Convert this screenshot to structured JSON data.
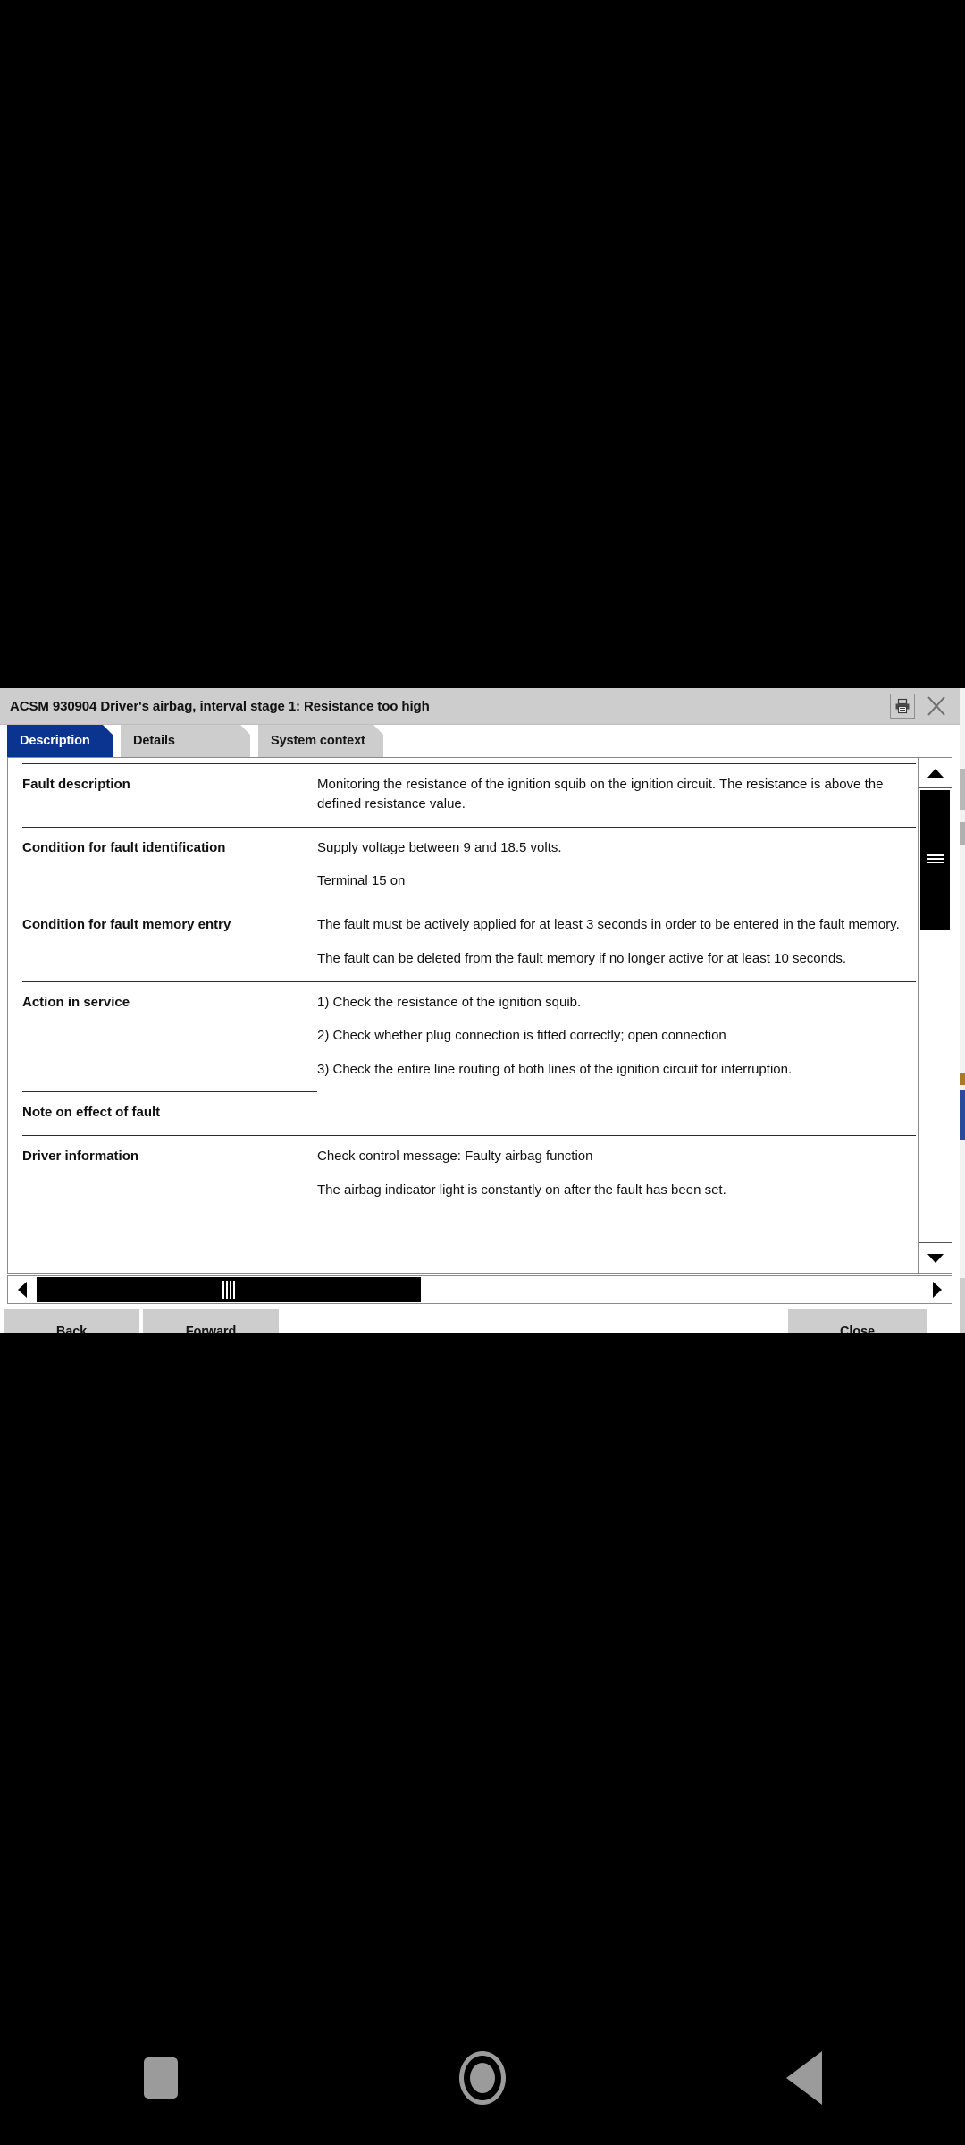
{
  "window": {
    "title": "ACSM 930904 Driver's airbag, interval stage 1: Resistance too high",
    "print_icon": "printer-icon",
    "close_icon": "close-x-icon",
    "accent_color": "#0b3491",
    "chrome_color": "#cdcdcd"
  },
  "tabs": [
    {
      "label": "Description",
      "active": true
    },
    {
      "label": "Details",
      "active": false
    },
    {
      "label": "System context",
      "active": false
    }
  ],
  "table": {
    "rows": [
      {
        "label": "Fault description",
        "paragraphs": [
          "Monitoring the resistance of the ignition squib on the ignition circuit. The resistance is above the defined resistance value."
        ]
      },
      {
        "label": "Condition for fault identification",
        "paragraphs": [
          "Supply voltage between 9 and 18.5 volts.",
          "Terminal 15 on"
        ]
      },
      {
        "label": "Condition for fault memory entry",
        "paragraphs": [
          "The fault must be actively applied for at least 3 seconds in order to be entered in the fault memory.",
          "The fault can be deleted from the fault memory if no longer active for at least 10 seconds."
        ]
      },
      {
        "label": "Action in service",
        "paragraphs": [
          "1) Check the resistance of the ignition squib.",
          "2) Check whether plug connection is fitted correctly; open connection",
          "3) Check the entire line routing of both lines of the ignition circuit for interruption."
        ]
      },
      {
        "label": "Note on effect of fault",
        "paragraphs": []
      },
      {
        "label": "Driver information",
        "paragraphs": [
          "Check control message: Faulty airbag function",
          "The airbag indicator light is constantly on after the fault has been set."
        ]
      }
    ]
  },
  "scrollbars": {
    "vertical": {
      "up_icon": "triangle-up-icon",
      "down_icon": "triangle-down-icon",
      "thumb_icon": "scroll-grip-icon"
    },
    "horizontal": {
      "left_icon": "triangle-left-icon",
      "right_icon": "triangle-right-icon",
      "thumb_icon": "scroll-grip-icon"
    }
  },
  "buttons": {
    "back": "Back",
    "forward": "Forward",
    "close": "Close"
  },
  "navbar": {
    "recents": "recents-square-icon",
    "home": "home-circle-icon",
    "back": "back-triangle-icon"
  }
}
